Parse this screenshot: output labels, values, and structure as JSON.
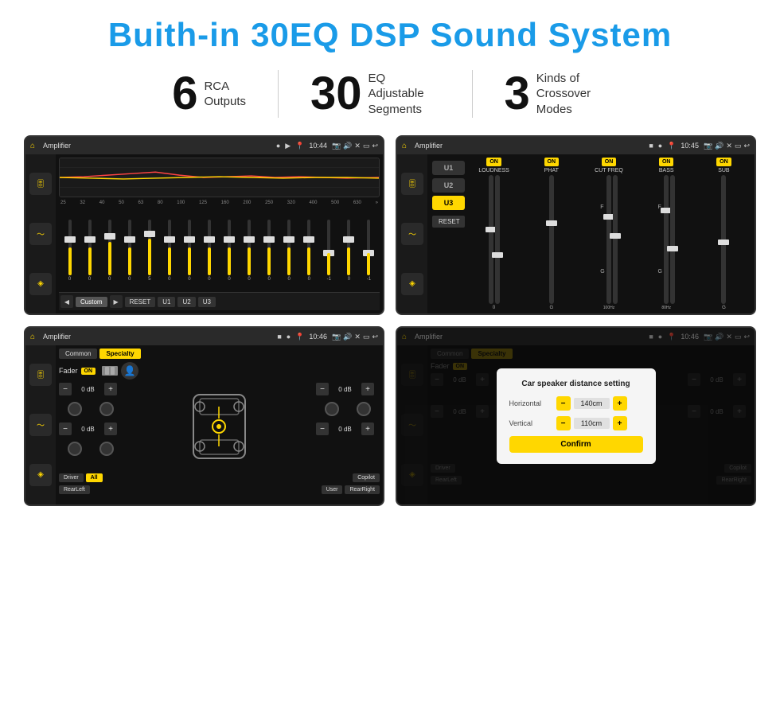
{
  "header": {
    "title": "Buith-in 30EQ DSP Sound System"
  },
  "stats": [
    {
      "number": "6",
      "label": "RCA\nOutputs"
    },
    {
      "number": "30",
      "label": "EQ Adjustable\nSegments"
    },
    {
      "number": "3",
      "label": "Kinds of\nCrossover Modes"
    }
  ],
  "screens": [
    {
      "id": "screen1",
      "topbar": {
        "title": "Amplifier",
        "time": "10:44"
      },
      "type": "eq"
    },
    {
      "id": "screen2",
      "topbar": {
        "title": "Amplifier",
        "time": "10:45"
      },
      "type": "crossover"
    },
    {
      "id": "screen3",
      "topbar": {
        "title": "Amplifier",
        "time": "10:46"
      },
      "type": "speaker"
    },
    {
      "id": "screen4",
      "topbar": {
        "title": "Amplifier",
        "time": "10:46"
      },
      "type": "speaker-dialog"
    }
  ],
  "eq": {
    "frequencies": [
      "25",
      "32",
      "40",
      "50",
      "63",
      "80",
      "100",
      "125",
      "160",
      "200",
      "250",
      "320",
      "400",
      "500",
      "630"
    ],
    "values": [
      "0",
      "0",
      "0",
      "0",
      "5",
      "0",
      "0",
      "0",
      "0",
      "0",
      "0",
      "0",
      "0",
      "-1",
      "0",
      "-1"
    ],
    "presets": [
      "Custom",
      "RESET",
      "U1",
      "U2",
      "U3"
    ]
  },
  "crossover": {
    "units": [
      "U1",
      "U2",
      "U3"
    ],
    "controls": [
      "LOUDNESS",
      "PHAT",
      "CUT FREQ",
      "BASS",
      "SUB"
    ],
    "resetLabel": "RESET"
  },
  "speaker": {
    "tabs": [
      "Common",
      "Specialty"
    ],
    "faderLabel": "Fader",
    "onLabel": "ON",
    "leftControls": [
      "0 dB",
      "0 dB"
    ],
    "rightControls": [
      "0 dB",
      "0 dB"
    ],
    "bottomBtns": [
      "Driver",
      "RearLeft",
      "All",
      "User",
      "Copilot",
      "RearRight"
    ]
  },
  "dialog": {
    "title": "Car speaker distance setting",
    "horizontalLabel": "Horizontal",
    "horizontalValue": "140cm",
    "verticalLabel": "Vertical",
    "verticalValue": "110cm",
    "confirmLabel": "Confirm"
  }
}
